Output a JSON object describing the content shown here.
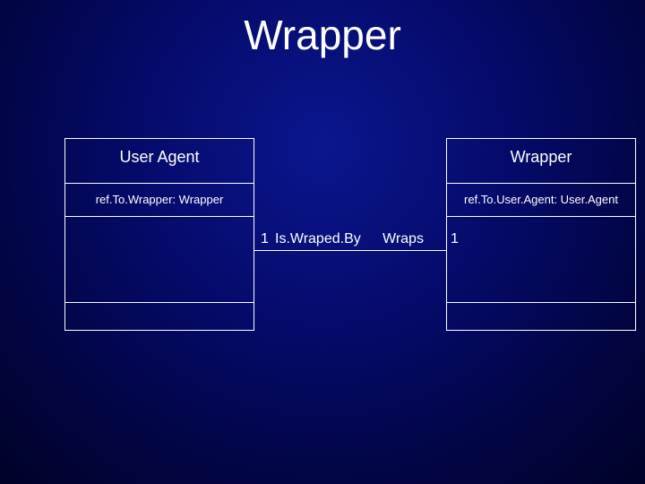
{
  "title": "Wrapper",
  "classes": {
    "left": {
      "name": "User Agent",
      "attribute": "ref.To.Wrapper: Wrapper"
    },
    "right": {
      "name": "Wrapper",
      "attribute": "ref.To.User.Agent: User.Agent"
    }
  },
  "association": {
    "left_multiplicity": "1",
    "left_role": "Is.Wraped.By",
    "right_role": "Wraps",
    "right_multiplicity": "1"
  },
  "chart_data": {
    "type": "table",
    "title": "Wrapper",
    "description": "UML class diagram showing a bidirectional association between User Agent and Wrapper",
    "classes": [
      {
        "name": "User Agent",
        "attributes": [
          "ref.To.Wrapper: Wrapper"
        ]
      },
      {
        "name": "Wrapper",
        "attributes": [
          "ref.To.User.Agent: User.Agent"
        ]
      }
    ],
    "associations": [
      {
        "endA": {
          "class": "User Agent",
          "role": "Is.Wraped.By",
          "multiplicity": "1"
        },
        "endB": {
          "class": "Wrapper",
          "role": "Wraps",
          "multiplicity": "1"
        }
      }
    ]
  }
}
